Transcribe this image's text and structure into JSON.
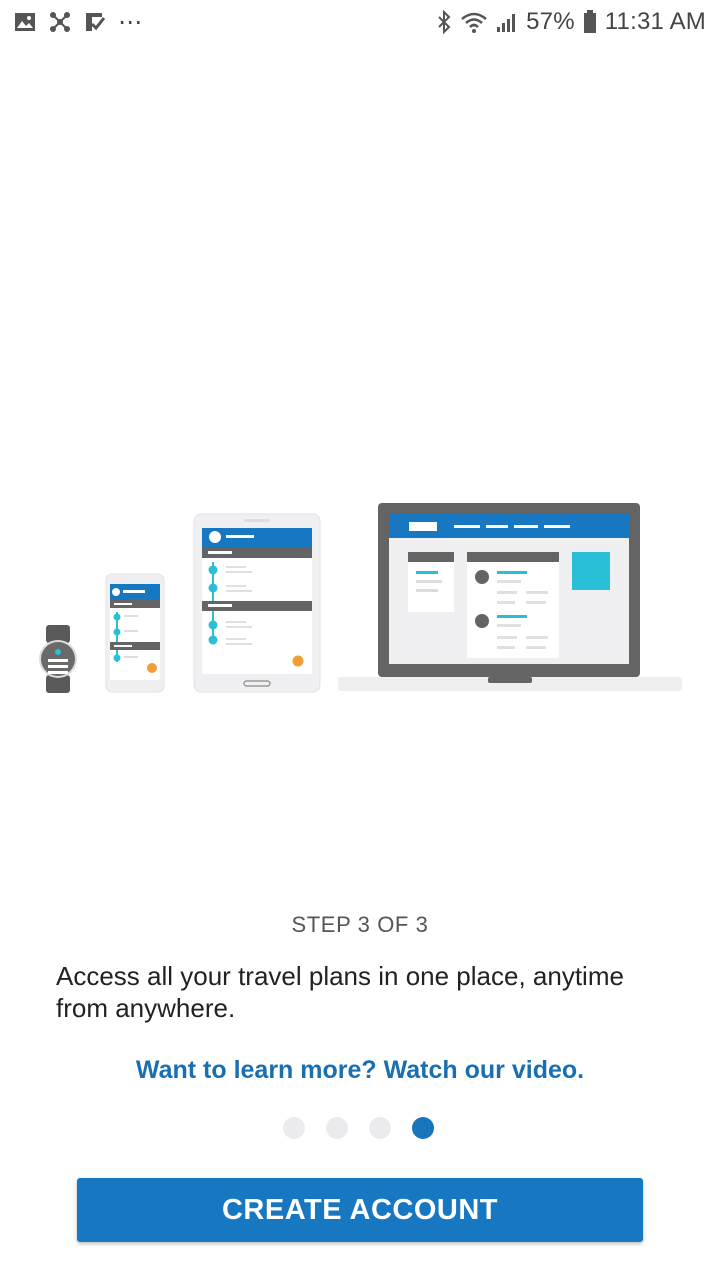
{
  "status_bar": {
    "battery": "57%",
    "time": "11:31 AM",
    "more": "⋯",
    "icons_left": [
      "image-icon",
      "network-icon",
      "task-check-icon",
      "more-icon"
    ],
    "icons_right": [
      "bluetooth-icon",
      "wifi-icon",
      "signal-icon",
      "battery-icon"
    ]
  },
  "onboarding": {
    "step_label": "STEP 3 OF 3",
    "description": "Access all your travel plans in one place, anytime from anywhere.",
    "video_link": "Want to learn more? Watch our video.",
    "pager": {
      "total": 4,
      "active_index": 3
    }
  },
  "actions": {
    "create_account_label": "CREATE ACCOUNT"
  },
  "colors": {
    "primary_blue": "#1877c1",
    "accent_teal": "#29bfd6",
    "accent_orange": "#f29e38",
    "device_gray": "#646464"
  }
}
